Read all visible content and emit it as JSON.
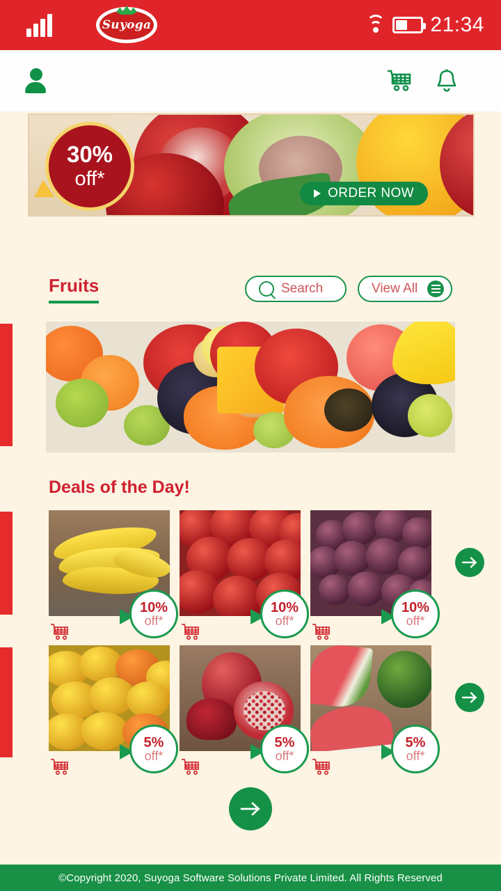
{
  "statusbar": {
    "signal_icon": "signal-bars-icon",
    "brand": "Suyoga",
    "wifi_icon": "wifi-icon",
    "battery_icon": "battery-icon",
    "time": "21:34"
  },
  "navbar": {
    "ghost_text": "Suyoga Fruits",
    "account_icon": "account-icon",
    "cart_icon": "cart-icon",
    "bell_icon": "bell-icon"
  },
  "banner": {
    "discount_percent": "30%",
    "discount_off": "off*",
    "cta_label": "ORDER NOW",
    "cta_icon": "play-triangle-icon"
  },
  "section": {
    "title": "Fruits",
    "search_label": "Search",
    "search_icon": "search-icon",
    "view_all_label": "View All",
    "view_all_icon": "menu-icon",
    "hero_alt": "assorted-fruits-banner"
  },
  "deals": {
    "title": "Deals of the Day!",
    "next_icon": "arrow-right-icon",
    "rows": [
      {
        "cards": [
          {
            "name": "Bananas",
            "discount_percent": "10%",
            "discount_off": "off*",
            "cart_icon": "add-to-cart-icon",
            "image": "bananas-image"
          },
          {
            "name": "Apples",
            "discount_percent": "10%",
            "discount_off": "off*",
            "cart_icon": "add-to-cart-icon",
            "image": "apples-image"
          },
          {
            "name": "Grapes",
            "discount_percent": "10%",
            "discount_off": "off*",
            "cart_icon": "add-to-cart-icon",
            "image": "grapes-image"
          }
        ]
      },
      {
        "cards": [
          {
            "name": "Mangoes",
            "discount_percent": "5%",
            "discount_off": "off*",
            "cart_icon": "add-to-cart-icon",
            "image": "mangoes-image"
          },
          {
            "name": "Pomegranates",
            "discount_percent": "5%",
            "discount_off": "off*",
            "cart_icon": "add-to-cart-icon",
            "image": "pomegranates-image"
          },
          {
            "name": "Watermelon",
            "discount_percent": "5%",
            "discount_off": "off*",
            "cart_icon": "add-to-cart-icon",
            "image": "watermelon-image"
          }
        ]
      }
    ]
  },
  "pagination": {
    "next_icon": "arrow-right-icon"
  },
  "footer": {
    "text": "©Copyright 2020, Suyoga Software Solutions Private Limited. All Rights Reserved"
  },
  "colors": {
    "brand_red": "#e0252a",
    "brand_green": "#149146",
    "title_red": "#cf2030",
    "page_bg": "#fdf4e3",
    "badge_border": "#1a9a4e"
  }
}
